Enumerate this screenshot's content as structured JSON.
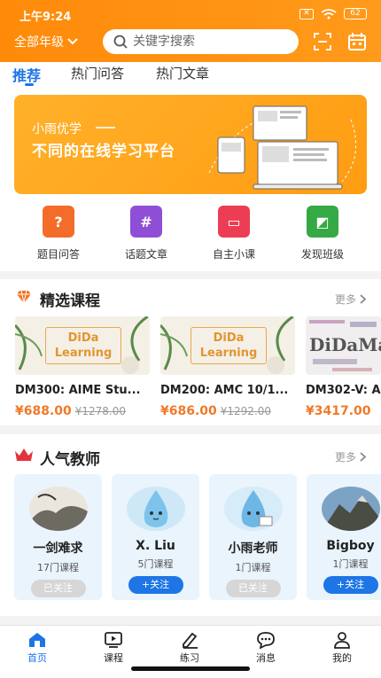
{
  "status_bar": {
    "time": "上午9:24",
    "battery": "62"
  },
  "header": {
    "grade_selector": "全部年级",
    "search_placeholder": "关键字搜索"
  },
  "tabs": [
    {
      "label": "推荐",
      "active": true
    },
    {
      "label": "热门问答",
      "active": false
    },
    {
      "label": "热门文章",
      "active": false
    }
  ],
  "banner": {
    "brand": "小雨优学",
    "slogan": "不同的在线学习平台"
  },
  "quick_nav": [
    {
      "label": "题目问答",
      "icon": "question-bubble-icon",
      "color": "#f36c2a"
    },
    {
      "label": "话题文章",
      "icon": "hash-icon",
      "color": "#8e4fd6"
    },
    {
      "label": "自主小课",
      "icon": "presentation-board-icon",
      "color": "#ec3d55"
    },
    {
      "label": "发现班级",
      "icon": "chalkboard-icon",
      "color": "#35a944"
    }
  ],
  "courses_section": {
    "title": "精选课程",
    "more": "更多",
    "items": [
      {
        "title": "DM300: AIME Stu...",
        "price": "¥688.00",
        "original_price": "¥1278.00",
        "thumb_text": "DiDa Learning"
      },
      {
        "title": "DM200: AMC 10/1...",
        "price": "¥686.00",
        "original_price": "¥1292.00",
        "thumb_text": "DiDa Learning"
      },
      {
        "title": "DM302-V: A",
        "price": "¥3417.00",
        "original_price": "",
        "thumb_text": "DiDaMa"
      }
    ]
  },
  "teachers_section": {
    "title": "人气教师",
    "more": "更多",
    "items": [
      {
        "name": "一剑难求",
        "courses": "17门课程",
        "follow": "已关注",
        "followed": true
      },
      {
        "name": "X. Liu",
        "courses": "5门课程",
        "follow": "+关注",
        "followed": false
      },
      {
        "name": "小雨老师",
        "courses": "1门课程",
        "follow": "已关注",
        "followed": true
      },
      {
        "name": "Bigboy",
        "courses": "1门课程",
        "follow": "+关注",
        "followed": false
      }
    ]
  },
  "bottom_nav": [
    {
      "label": "首页",
      "icon": "home-icon",
      "active": true
    },
    {
      "label": "课程",
      "icon": "video-play-icon",
      "active": false
    },
    {
      "label": "练习",
      "icon": "pencil-icon",
      "active": false
    },
    {
      "label": "消息",
      "icon": "chat-bubble-icon",
      "active": false
    },
    {
      "label": "我的",
      "icon": "person-icon",
      "active": false
    }
  ],
  "colors": {
    "brand_orange": "#ff8a0a",
    "accent_blue": "#1c74e6",
    "price_orange": "#f0792a"
  }
}
